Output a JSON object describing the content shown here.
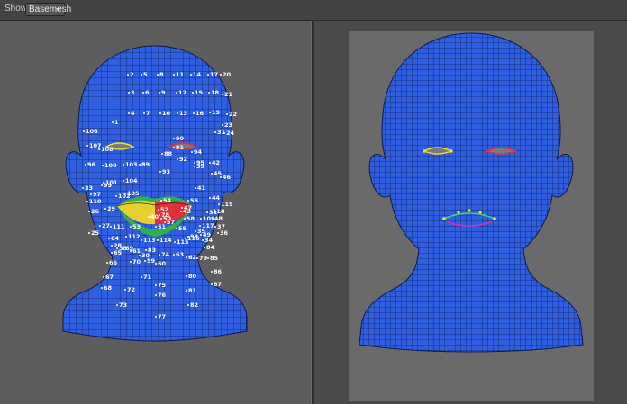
{
  "toolbar": {
    "show_label": "Show",
    "mode_value": "Basemesh"
  },
  "left_viewport": {
    "landmark_labels": [
      "2",
      "5",
      "8",
      "11",
      "14",
      "17",
      "20",
      "3",
      "6",
      "9",
      "12",
      "15",
      "18",
      "21",
      "4",
      "7",
      "10",
      "13",
      "16",
      "19",
      "22",
      "1",
      "23",
      "24",
      "90",
      "106",
      "91",
      "94",
      "107",
      "108",
      "88",
      "92",
      "95",
      "96",
      "100",
      "103",
      "89",
      "93",
      "39",
      "42",
      "45",
      "101",
      "104",
      "41",
      "44",
      "97",
      "102",
      "99",
      "105",
      "54",
      "56",
      "119",
      "26",
      "118",
      "48",
      "37",
      "27",
      "111",
      "53",
      "58",
      "117",
      "36",
      "25",
      "112",
      "116",
      "64",
      "28",
      "113",
      "114",
      "115",
      "34",
      "84",
      "69",
      "65",
      "30",
      "74",
      "59",
      "63",
      "62",
      "79",
      "66",
      "70",
      "60",
      "71",
      "80",
      "85",
      "86",
      "67",
      "68",
      "72",
      "75",
      "81",
      "87",
      "73",
      "76",
      "77",
      "82",
      "78",
      "38",
      "61",
      "83",
      "52",
      "47",
      "46",
      "50",
      "57",
      "55",
      "51",
      "40",
      "43",
      "35",
      "98",
      "109",
      "110",
      "33",
      "29",
      "49",
      "32",
      "31"
    ]
  },
  "colors": {
    "mesh_fill": "#2f5fe0",
    "mesh_line": "#10225e",
    "lip_yellow": "#e8d030",
    "lip_red": "#e0303a",
    "lip_green": "#2fb04a",
    "eye_yellow": "#f0e020",
    "eye_red": "#e03040",
    "mouth_green": "#40d070",
    "mouth_magenta": "#d030c0"
  }
}
